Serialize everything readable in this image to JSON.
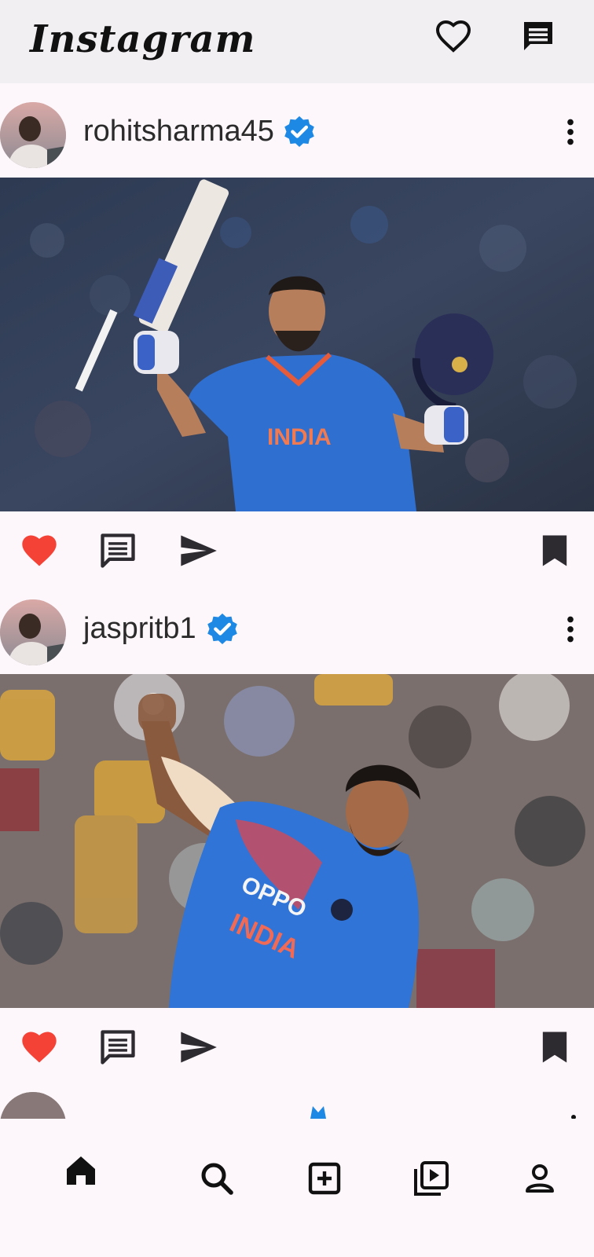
{
  "app": {
    "logo": "Instagram"
  },
  "header": {
    "icons": [
      "heart-outline-icon",
      "message-icon"
    ]
  },
  "posts": [
    {
      "username": "rohitsharma45",
      "verified": true,
      "liked": true,
      "image": "cricketer-celebrating-with-bat-and-helmet"
    },
    {
      "username": "jaspritb1",
      "verified": true,
      "liked": true,
      "image": "cricketer-bowling-action"
    }
  ],
  "post_actions": [
    "like-icon",
    "comment-icon",
    "share-icon",
    "bookmark-icon"
  ],
  "bottom_nav": [
    "home-icon",
    "search-icon",
    "add-post-icon",
    "reels-icon",
    "profile-icon"
  ],
  "colors": {
    "like": "#f44336",
    "verified": "#1e88e5",
    "icon": "#2d2a30",
    "background": "#fdf7fb"
  }
}
